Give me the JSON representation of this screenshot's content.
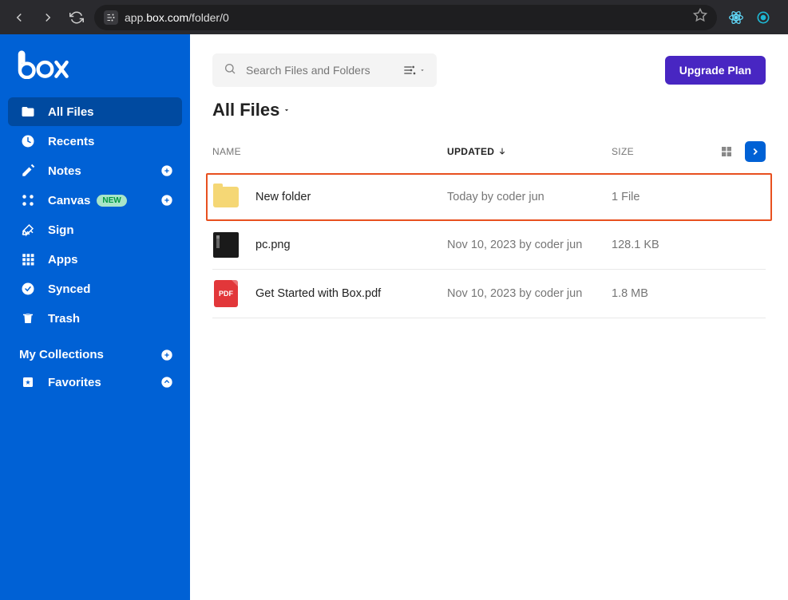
{
  "browser": {
    "url_prefix": "app.",
    "url_domain": "box.com",
    "url_path": "/folder/0"
  },
  "sidebar": {
    "items": [
      {
        "label": "All Files",
        "icon": "folder-icon",
        "active": true
      },
      {
        "label": "Recents",
        "icon": "clock-icon"
      },
      {
        "label": "Notes",
        "icon": "notes-icon",
        "plus": true
      },
      {
        "label": "Canvas",
        "icon": "canvas-icon",
        "badge": "NEW",
        "plus": true
      },
      {
        "label": "Sign",
        "icon": "sign-icon"
      },
      {
        "label": "Apps",
        "icon": "apps-icon"
      },
      {
        "label": "Synced",
        "icon": "synced-icon"
      },
      {
        "label": "Trash",
        "icon": "trash-icon"
      }
    ],
    "collections_header": "My Collections",
    "favorites_label": "Favorites"
  },
  "search": {
    "placeholder": "Search Files and Folders"
  },
  "upgrade_label": "Upgrade Plan",
  "page_title": "All Files",
  "columns": {
    "name": "NAME",
    "updated": "UPDATED",
    "size": "SIZE"
  },
  "files": [
    {
      "name": "New folder",
      "type": "folder",
      "updated": "Today by coder jun",
      "size": "1 File",
      "highlighted": true
    },
    {
      "name": "pc.png",
      "type": "image",
      "updated": "Nov 10, 2023 by coder jun",
      "size": "128.1 KB"
    },
    {
      "name": "Get Started with Box.pdf",
      "type": "pdf",
      "updated": "Nov 10, 2023 by coder jun",
      "size": "1.8 MB",
      "pdf_label": "PDF"
    }
  ]
}
